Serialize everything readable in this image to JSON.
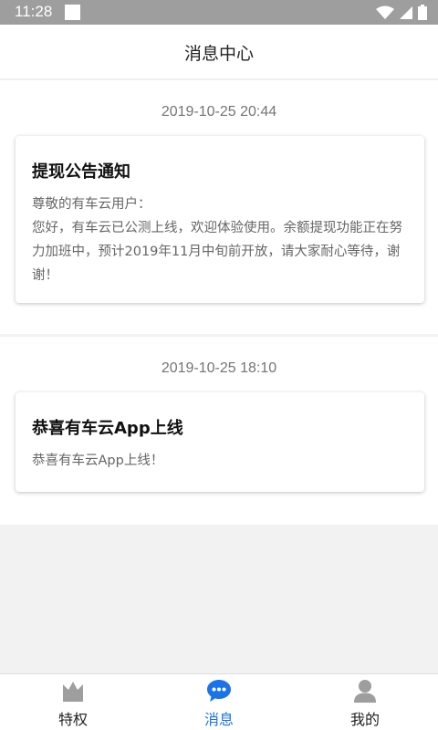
{
  "status_bar": {
    "time": "11:28"
  },
  "header": {
    "title": "消息中心"
  },
  "messages": [
    {
      "time": "2019-10-25 20:44",
      "title": "提现公告通知",
      "body": [
        "尊敬的有车云用户：",
        "您好，有车云已公测上线，欢迎体验使用。余额提现功能正在努",
        "力加班中，预计2019年11月中旬前开放，请大家耐心等待，谢",
        "谢！"
      ]
    },
    {
      "time": "2019-10-25 18:10",
      "title": "恭喜有车云App上线",
      "body": [
        "恭喜有车云App上线！"
      ]
    }
  ],
  "tabs": [
    {
      "label": "特权",
      "icon": "crown-icon",
      "active": false
    },
    {
      "label": "消息",
      "icon": "chat-icon",
      "active": true
    },
    {
      "label": "我的",
      "icon": "user-icon",
      "active": false
    }
  ],
  "colors": {
    "accent": "#1a73e8",
    "tab_inactive_icon": "#9e9e9e",
    "status_bar": "#9e9e9e"
  }
}
